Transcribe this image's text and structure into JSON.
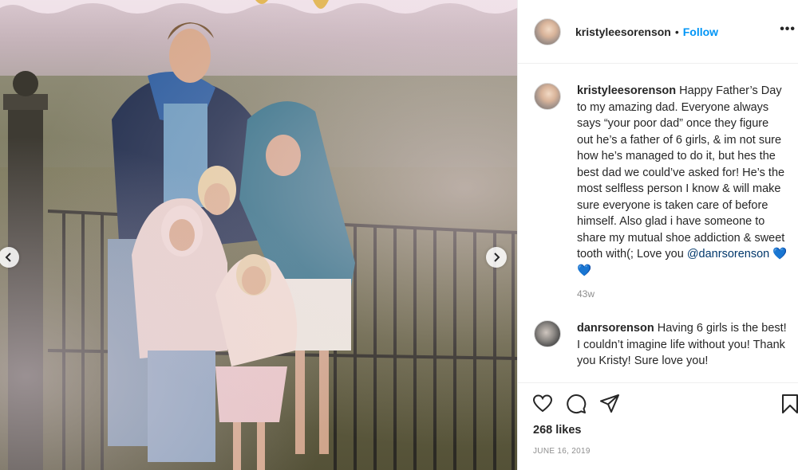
{
  "post": {
    "author": "kristyleesorenson",
    "separator": "•",
    "follow_label": "Follow",
    "more_label": "•••"
  },
  "comments": [
    {
      "username": "kristyleesorenson",
      "text": "Happy Father’s Day to my amazing dad. Everyone always says “your poor dad” once they figure out he’s a father of 6 girls, & im not sure how he’s managed to do it, but hes the best dad we could’ve asked for! He’s the most selfless person I know & will make sure everyone is taken care of before himself. Also glad i have someone to share my mutual shoe addiction & sweet tooth with(; Love you ",
      "mention": "@danrsorenson",
      "hearts": "💙💙",
      "time": "43w"
    },
    {
      "username": "danrsorenson",
      "text": "Having 6 girls is the best! I couldn’t imagine life without you! Thank you Kristy! Sure love you!"
    }
  ],
  "likes": "268 likes",
  "date": "JUNE 16, 2019",
  "icons": {
    "like": "heart-icon",
    "comment": "comment-icon",
    "share": "share-icon",
    "save": "bookmark-icon",
    "prev": "chevron-left-icon",
    "next": "chevron-right-icon"
  },
  "colors": {
    "accent": "#0095f6",
    "mention": "#00376b",
    "muted": "#8e8e8e"
  }
}
